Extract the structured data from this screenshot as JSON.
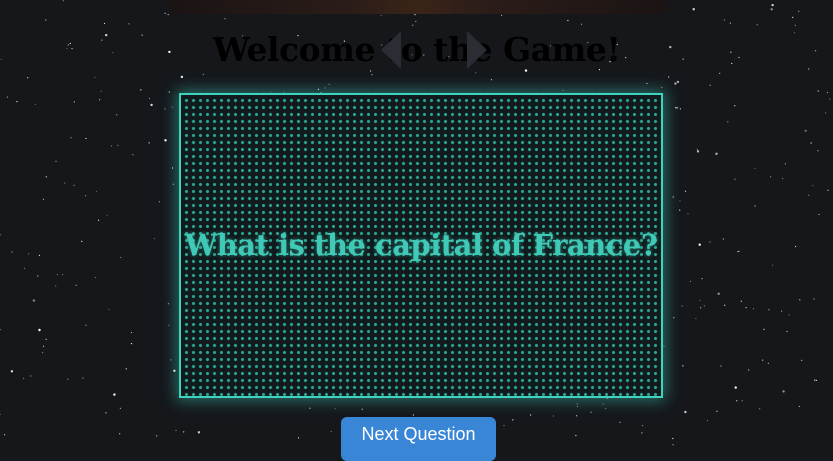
{
  "game": {
    "title": "Welcome to the Game!",
    "question": "What is the capital of France?",
    "next_button_label": "Next Question"
  },
  "colors": {
    "background": "#15171b",
    "accent": "#3fd3bf",
    "button": "#3a86d6"
  },
  "icons": {
    "prev": "triangle-left-icon",
    "next": "triangle-right-icon"
  }
}
